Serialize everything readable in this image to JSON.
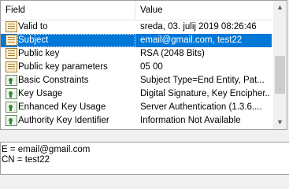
{
  "columns": {
    "field": "Field",
    "value": "Value"
  },
  "rows": [
    {
      "icon": "certificate-property-icon",
      "field": "Valid to",
      "value": "sreda, 03. julij 2019 08:26:46",
      "selected": false
    },
    {
      "icon": "certificate-property-icon",
      "field": "Subject",
      "value": "email@gmail.com, test22",
      "selected": true
    },
    {
      "icon": "certificate-property-icon",
      "field": "Public key",
      "value": "RSA (2048 Bits)",
      "selected": false
    },
    {
      "icon": "certificate-property-icon",
      "field": "Public key parameters",
      "value": "05 00",
      "selected": false
    },
    {
      "icon": "certificate-extension-icon",
      "field": "Basic Constraints",
      "value": "Subject Type=End Entity, Pat...",
      "selected": false
    },
    {
      "icon": "certificate-extension-icon",
      "field": "Key Usage",
      "value": "Digital Signature, Key Encipher...",
      "selected": false
    },
    {
      "icon": "certificate-extension-icon",
      "field": "Enhanced Key Usage",
      "value": "Server Authentication (1.3.6....",
      "selected": false
    },
    {
      "icon": "certificate-extension-icon",
      "field": "Authority Key Identifier",
      "value": "Information Not Available",
      "selected": false
    }
  ],
  "scrollbar": {
    "up_glyph": "▲",
    "down_glyph": "▼"
  },
  "detail": {
    "lines": [
      "E = email@gmail.com",
      "CN = test22"
    ]
  }
}
